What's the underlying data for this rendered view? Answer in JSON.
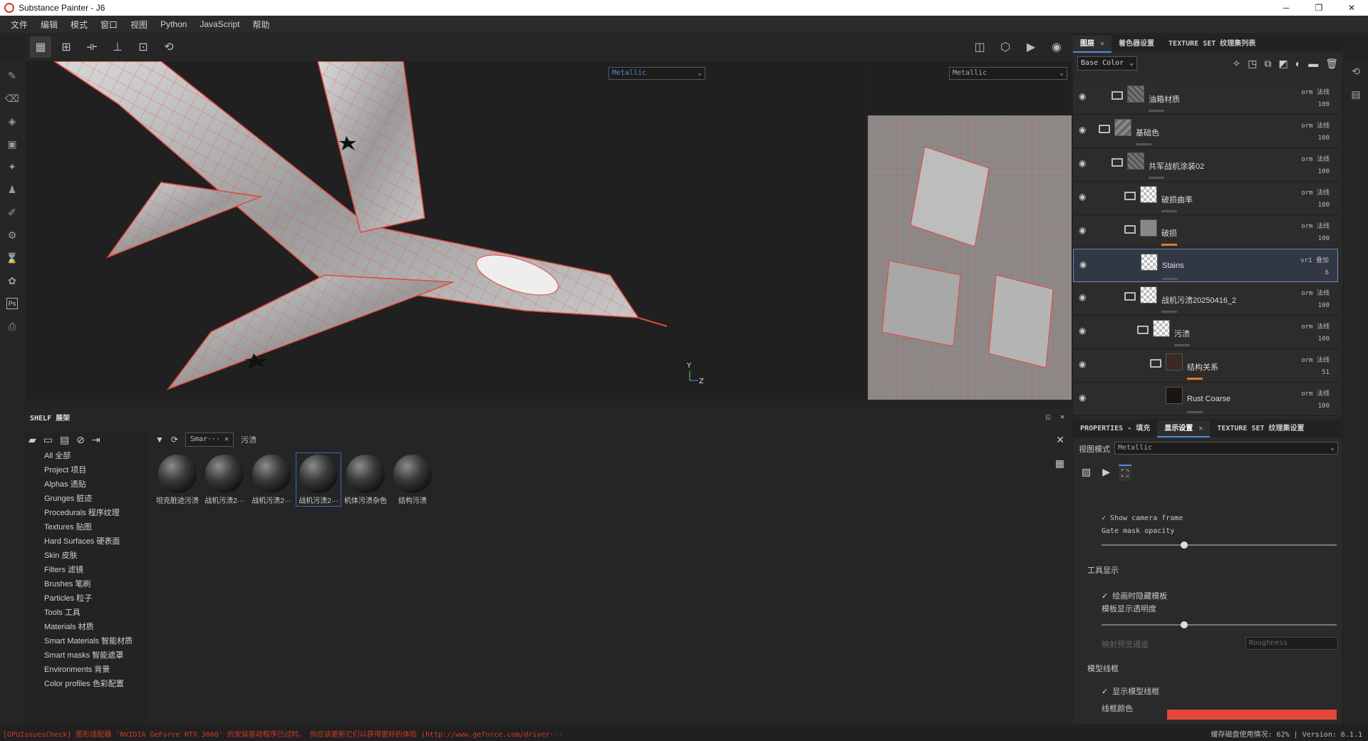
{
  "window": {
    "title": "Substance Painter - J6",
    "controls": [
      "─",
      "❐",
      "✕"
    ]
  },
  "menu": [
    "文件",
    "编辑",
    "模式",
    "窗口",
    "视图",
    "Python",
    "JavaScript",
    "帮助"
  ],
  "viewport": {
    "left_channel": "Metallic",
    "right_channel": "Metallic",
    "axis_y": "Y",
    "axis_z": "Z"
  },
  "layers_panel": {
    "tabs": [
      {
        "label": "图层",
        "active": true,
        "closable": true
      },
      {
        "label": "着色器设置",
        "active": false,
        "closable": false
      },
      {
        "label": "TEXTURE SET 纹理集列表",
        "active": false,
        "closable": false
      }
    ],
    "channel": "Base Color",
    "layers": [
      {
        "name": "油箱材质",
        "blend": "orm 法线",
        "opacity": "100",
        "indent": 0,
        "folder": true,
        "thumb": "tex",
        "sel": false,
        "bar": ""
      },
      {
        "name": "基础色",
        "blend": "orm 法线",
        "opacity": "100",
        "indent": -1,
        "folder": true,
        "thumb": "tex2",
        "sel": false,
        "bar": ""
      },
      {
        "name": "共军战机涂装02",
        "blend": "orm 法线",
        "opacity": "100",
        "indent": 0,
        "folder": true,
        "thumb": "tex",
        "sel": false,
        "bar": ""
      },
      {
        "name": "破损曲率",
        "blend": "orm 法线",
        "opacity": "100",
        "indent": 1,
        "folder": true,
        "thumb": "checker-black",
        "sel": false,
        "bar": ""
      },
      {
        "name": "破损",
        "blend": "orm 法线",
        "opacity": "100",
        "indent": 1,
        "folder": true,
        "thumb": "grey-noise",
        "sel": false,
        "bar": "orange"
      },
      {
        "name": "Stains",
        "blend": "vr1 叠加",
        "opacity": "6",
        "indent": 1,
        "folder": false,
        "thumb": "checker",
        "sel": true,
        "bar": ""
      },
      {
        "name": "战机污渍20250416_2",
        "blend": "orm 法线",
        "opacity": "100",
        "indent": 1,
        "folder": true,
        "thumb": "checker",
        "sel": false,
        "bar": ""
      },
      {
        "name": "污渍",
        "blend": "orm 法线",
        "opacity": "100",
        "indent": 2,
        "folder": true,
        "thumb": "checker",
        "sel": false,
        "bar": ""
      },
      {
        "name": "结构关系",
        "blend": "orm 法线",
        "opacity": "51",
        "indent": 3,
        "folder": true,
        "thumb": "dark-noise",
        "sel": false,
        "bar": "orange"
      },
      {
        "name": "Rust Coarse",
        "blend": "orm 法线",
        "opacity": "100",
        "indent": 3,
        "folder": false,
        "thumb": "dark",
        "sel": false,
        "bar": ""
      }
    ]
  },
  "properties_panel": {
    "tabs": [
      {
        "label": "PROPERTIES - 填充",
        "active": false,
        "closable": false
      },
      {
        "label": "显示设置",
        "active": true,
        "closable": true
      },
      {
        "label": "TEXTURE SET 纹理集设置",
        "active": false,
        "closable": false
      }
    ],
    "view_mode_label": "视图模式",
    "view_mode_value": "Metallic",
    "show_camera_frame": "Show camera frame",
    "gate_mask_opacity": "Gate mask opacity",
    "gate_mask_value": 0.35,
    "tool_display": "工具显示",
    "hide_stencil": "绘画时隐藏模板",
    "stencil_opacity": "模板显示透明度",
    "stencil_value": 0.35,
    "map_preview": "映射预览通道",
    "map_preview_value": "Roughness",
    "wireframe": "模型线框",
    "show_wireframe": "显示模型线框",
    "wireframe_color": "线框颜色"
  },
  "shelf": {
    "title": "SHELF 展架",
    "categories": [
      "All 全部",
      "Project 项目",
      "Alphas 透贴",
      "Grunges 脏迹",
      "Procedurals 程序纹理",
      "Textures 贴图",
      "Hard Surfaces 硬表面",
      "Skin 皮肤",
      "Filters 滤镜",
      "Brushes 笔刷",
      "Particles 粒子",
      "Tools 工具",
      "Materials 材质",
      "Smart Materials 智能材质",
      "Smart masks 智能遮罩",
      "Environments 背景",
      "Color profiles 色彩配置"
    ],
    "filter_chip": "Smar···",
    "search": "污渍",
    "items": [
      {
        "label": "坦克脏迹污渍",
        "sel": false
      },
      {
        "label": "战机污渍2···",
        "sel": false
      },
      {
        "label": "战机污渍2···",
        "sel": false
      },
      {
        "label": "战机污渍2···",
        "sel": true
      },
      {
        "label": "机体污渍杂色",
        "sel": false
      },
      {
        "label": "结构污渍",
        "sel": false
      }
    ]
  },
  "status": {
    "message": "[GPUIssuesCheck] 图形适配器 'NVIDIA GeForce RTX 3060' 的安装驱动程序已过时。 你应该更新它们以获得更好的体验 (http://www.geforce.com/driver···",
    "disk": "缓存磁盘使用情况:",
    "disk_value": "62%",
    "version": "Version: 6.1.1"
  },
  "colors": {
    "accent": "#4a8fd8",
    "wire": "#e5483a",
    "warn": "#d23a2a"
  }
}
